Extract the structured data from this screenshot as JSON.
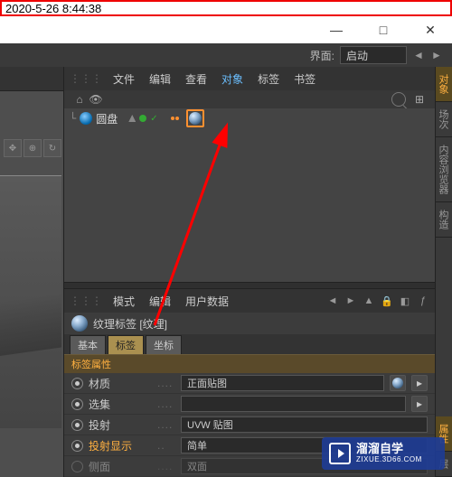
{
  "timestamp": "2020-5-26 8:44:38",
  "win": {
    "min": "—",
    "max": "□",
    "close": "✕"
  },
  "layout": {
    "label": "界面:",
    "value": "启动"
  },
  "rtabs": [
    "对象",
    "场次",
    "内容浏览器",
    "构造"
  ],
  "rtabs2": [
    "属性",
    "层"
  ],
  "om_menu": {
    "file": "文件",
    "edit": "编辑",
    "view": "查看",
    "object": "对象",
    "tags": "标签",
    "bookmarks": "书签"
  },
  "object": {
    "name": "圆盘"
  },
  "am_menu": {
    "mode": "模式",
    "edit": "编辑",
    "userdata": "用户数据"
  },
  "am_head": "纹理标签 [纹理]",
  "am_tabs": {
    "base": "基本",
    "tag": "标签",
    "coord": "坐标"
  },
  "section": "标签属性",
  "props": {
    "material": {
      "label": "材质",
      "value": "正面贴图"
    },
    "selection": {
      "label": "选集",
      "value": ""
    },
    "projection": {
      "label": "投射",
      "value": "UVW 贴图"
    },
    "display": {
      "label": "投射显示",
      "value": "简单"
    },
    "side": {
      "label": "侧面",
      "value": "双面"
    }
  },
  "watermark": {
    "t1": "溜溜自学",
    "t2": "ZIXUE.3D66.COM"
  }
}
